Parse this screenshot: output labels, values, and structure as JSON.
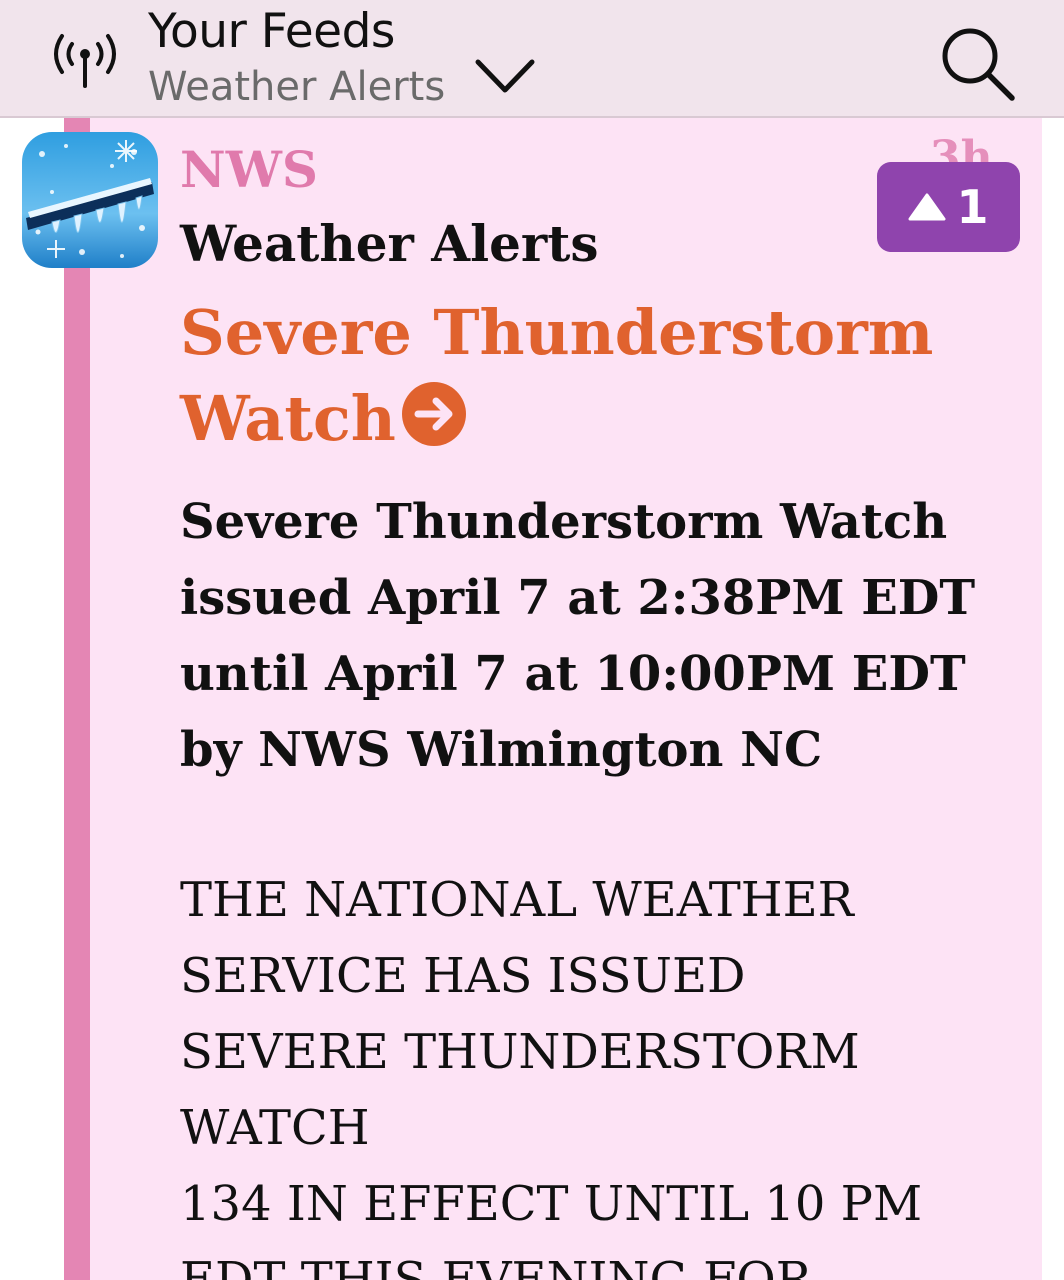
{
  "header": {
    "title": "Your Feeds",
    "subtitle": "Weather Alerts",
    "icons": {
      "left": "antenna-icon",
      "dropdown": "chevron-down-icon",
      "right": "search-icon"
    }
  },
  "post": {
    "source": "NWS",
    "time_ago": "3h",
    "vote_count": "1",
    "feed_name": "Weather Alerts",
    "title_lines": [
      "Severe Thunderstorm",
      "Watch"
    ],
    "summary_lines": [
      "Severe Thunderstorm Watch",
      "issued April 7 at 2:38PM EDT",
      "until April 7 at 10:00PM EDT",
      "by NWS Wilmington NC"
    ],
    "body_lines": [
      "THE NATIONAL WEATHER",
      "SERVICE HAS ISSUED",
      "SEVERE THUNDERSTORM",
      "WATCH",
      "134 IN EFFECT UNTIL 10 PM",
      "EDT THIS EVENING FOR"
    ]
  },
  "colors": {
    "header_bg": "#f1e4ec",
    "card_bg": "#fde3f5",
    "card_accent": "#e486b4",
    "source": "#e07aac",
    "title": "#e0622e",
    "badge": "#8f44ad"
  }
}
